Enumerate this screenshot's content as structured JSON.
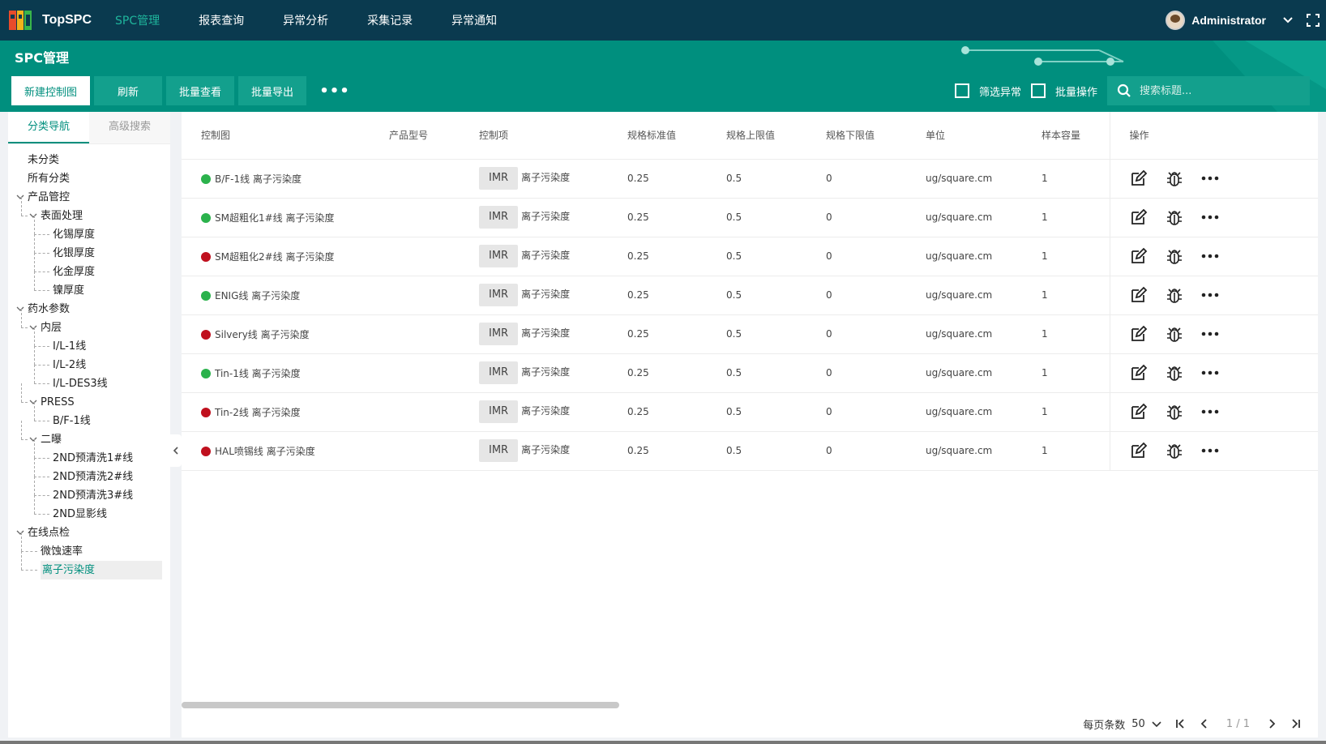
{
  "app": {
    "name": "TopSPC",
    "user": "Administrator"
  },
  "nav": [
    "SPC管理",
    "报表查询",
    "异常分析",
    "采集记录",
    "异常通知"
  ],
  "page": {
    "title": "SPC管理"
  },
  "toolbar": {
    "new_chart": "新建控制图",
    "refresh": "刷新",
    "batch_view": "批量查看",
    "batch_export": "批量导出",
    "more": "•••"
  },
  "filters": {
    "abnormal": "筛选异常",
    "batch_op": "批量操作"
  },
  "search": {
    "placeholder": "搜索标题..."
  },
  "sidebar": {
    "tabs": [
      "分类导航",
      "高级搜索"
    ],
    "tree": [
      {
        "label": "未分类",
        "level": 0
      },
      {
        "label": "所有分类",
        "level": 0
      },
      {
        "label": "产品管控",
        "level": 0,
        "expanded": true
      },
      {
        "label": "表面处理",
        "level": 1,
        "expanded": true
      },
      {
        "label": "化锡厚度",
        "level": 2
      },
      {
        "label": "化银厚度",
        "level": 2
      },
      {
        "label": "化金厚度",
        "level": 2
      },
      {
        "label": "镍厚度",
        "level": 2
      },
      {
        "label": "药水参数",
        "level": 0,
        "expanded": true
      },
      {
        "label": "内层",
        "level": 1,
        "expanded": true
      },
      {
        "label": "I/L-1线",
        "level": 2
      },
      {
        "label": "I/L-2线",
        "level": 2
      },
      {
        "label": "I/L-DES3线",
        "level": 2
      },
      {
        "label": "PRESS",
        "level": 1,
        "expanded": true
      },
      {
        "label": "B/F-1线",
        "level": 2
      },
      {
        "label": "二曝",
        "level": 1,
        "expanded": true
      },
      {
        "label": "2ND预清洗1#线",
        "level": 2
      },
      {
        "label": "2ND预清洗2#线",
        "level": 2
      },
      {
        "label": "2ND预清洗3#线",
        "level": 2
      },
      {
        "label": "2ND显影线",
        "level": 2
      },
      {
        "label": "在线点检",
        "level": 0,
        "expanded": true
      },
      {
        "label": "微蚀速率",
        "level": 1
      },
      {
        "label": "离子污染度",
        "level": 1,
        "selected": true
      }
    ]
  },
  "table": {
    "columns": [
      "控制图",
      "产品型号",
      "控制项",
      "规格标准值",
      "规格上限值",
      "规格下限值",
      "单位",
      "样本容量",
      "操作"
    ],
    "rows": [
      {
        "status": "green",
        "name": "B/F-1线 离子污染度",
        "model": "",
        "tag": "IMR",
        "item": "离子污染度",
        "std": "0.25",
        "usl": "0.5",
        "lsl": "0",
        "unit": "ug/square.cm",
        "n": "1"
      },
      {
        "status": "green",
        "name": "SM超粗化1#线 离子污染度",
        "model": "",
        "tag": "IMR",
        "item": "离子污染度",
        "std": "0.25",
        "usl": "0.5",
        "lsl": "0",
        "unit": "ug/square.cm",
        "n": "1"
      },
      {
        "status": "red",
        "name": "SM超粗化2#线 离子污染度",
        "model": "",
        "tag": "IMR",
        "item": "离子污染度",
        "std": "0.25",
        "usl": "0.5",
        "lsl": "0",
        "unit": "ug/square.cm",
        "n": "1"
      },
      {
        "status": "green",
        "name": "ENIG线 离子污染度",
        "model": "",
        "tag": "IMR",
        "item": "离子污染度",
        "std": "0.25",
        "usl": "0.5",
        "lsl": "0",
        "unit": "ug/square.cm",
        "n": "1"
      },
      {
        "status": "red",
        "name": "Silvery线 离子污染度",
        "model": "",
        "tag": "IMR",
        "item": "离子污染度",
        "std": "0.25",
        "usl": "0.5",
        "lsl": "0",
        "unit": "ug/square.cm",
        "n": "1"
      },
      {
        "status": "green",
        "name": "Tin-1线 离子污染度",
        "model": "",
        "tag": "IMR",
        "item": "离子污染度",
        "std": "0.25",
        "usl": "0.5",
        "lsl": "0",
        "unit": "ug/square.cm",
        "n": "1"
      },
      {
        "status": "red",
        "name": "Tin-2线 离子污染度",
        "model": "",
        "tag": "IMR",
        "item": "离子污染度",
        "std": "0.25",
        "usl": "0.5",
        "lsl": "0",
        "unit": "ug/square.cm",
        "n": "1"
      },
      {
        "status": "red",
        "name": "HAL喷锡线 离子污染度",
        "model": "",
        "tag": "IMR",
        "item": "离子污染度",
        "std": "0.25",
        "usl": "0.5",
        "lsl": "0",
        "unit": "ug/square.cm",
        "n": "1"
      }
    ]
  },
  "pager": {
    "per_page_label": "每页条数",
    "per_page": "50",
    "page_info": "1 / 1"
  },
  "colors": {
    "topbar": "#0a3a4f",
    "primary": "#008f7e",
    "green": "#2bb24c",
    "red": "#c0101e"
  }
}
